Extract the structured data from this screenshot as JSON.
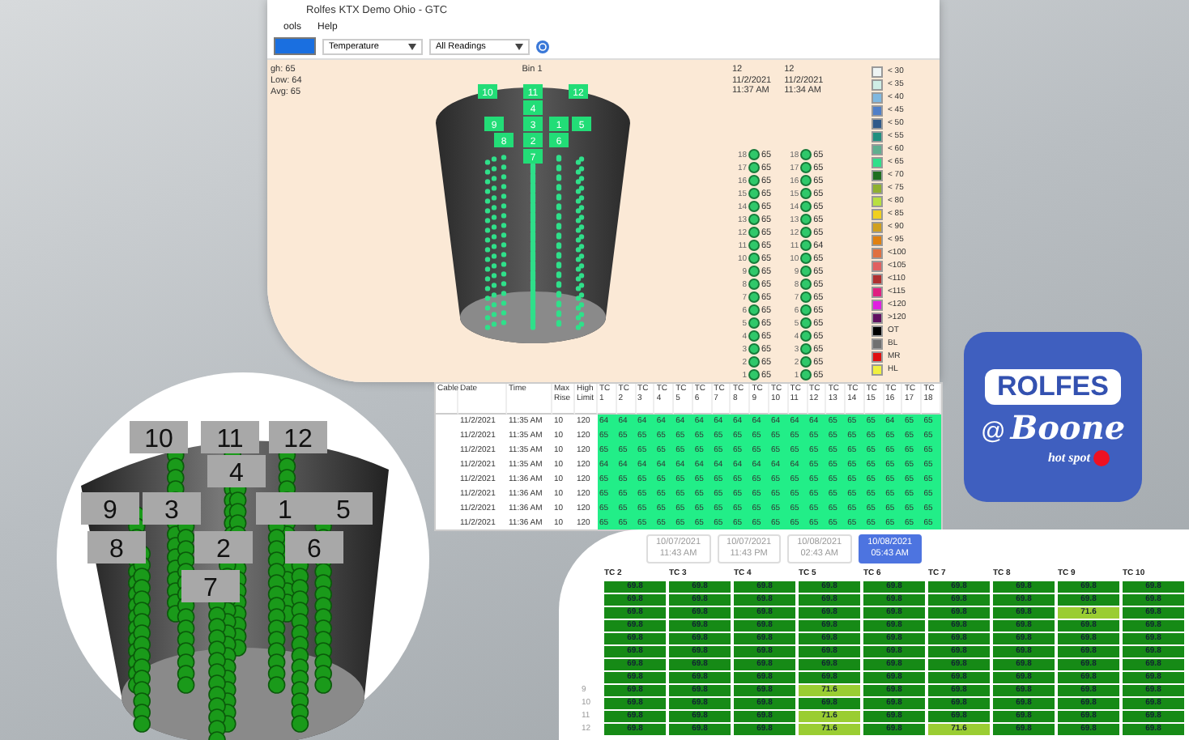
{
  "window": {
    "title": "Rolfes KTX Demo Ohio - GTC",
    "menu": [
      "ools",
      "Help"
    ],
    "toolbar": {
      "dropdowns": [
        "Temperature",
        "All Readings"
      ]
    }
  },
  "stats": [
    "gh: 65",
    "Low: 64",
    "Avg: 65"
  ],
  "bin": {
    "title": "Bin 1",
    "cable_labels": [
      "10",
      "11",
      "12",
      "4",
      "9",
      "3",
      "1",
      "5",
      "8",
      "2",
      "6",
      "7"
    ]
  },
  "cable_readings": [
    {
      "cable": "12",
      "date": "11/2/2021",
      "time": "11:37 AM",
      "sensors": [
        {
          "number": "18",
          "value": "65"
        },
        {
          "number": "17",
          "value": "65"
        },
        {
          "number": "16",
          "value": "65"
        },
        {
          "number": "15",
          "value": "65"
        },
        {
          "number": "14",
          "value": "65"
        },
        {
          "number": "13",
          "value": "65"
        },
        {
          "number": "12",
          "value": "65"
        },
        {
          "number": "11",
          "value": "65"
        },
        {
          "number": "10",
          "value": "65"
        },
        {
          "number": "9",
          "value": "65"
        },
        {
          "number": "8",
          "value": "65"
        },
        {
          "number": "7",
          "value": "65"
        },
        {
          "number": "6",
          "value": "65"
        },
        {
          "number": "5",
          "value": "65"
        },
        {
          "number": "4",
          "value": "65"
        },
        {
          "number": "3",
          "value": "65"
        },
        {
          "number": "2",
          "value": "65"
        },
        {
          "number": "1",
          "value": "65"
        }
      ]
    },
    {
      "cable": "12",
      "date": "11/2/2021",
      "time": "11:34 AM",
      "sensors": [
        {
          "number": "18",
          "value": "65"
        },
        {
          "number": "17",
          "value": "65"
        },
        {
          "number": "16",
          "value": "65"
        },
        {
          "number": "15",
          "value": "65"
        },
        {
          "number": "14",
          "value": "65"
        },
        {
          "number": "13",
          "value": "65"
        },
        {
          "number": "12",
          "value": "65"
        },
        {
          "number": "11",
          "value": "64"
        },
        {
          "number": "10",
          "value": "65"
        },
        {
          "number": "9",
          "value": "65"
        },
        {
          "number": "8",
          "value": "65"
        },
        {
          "number": "7",
          "value": "65"
        },
        {
          "number": "6",
          "value": "65"
        },
        {
          "number": "5",
          "value": "65"
        },
        {
          "number": "4",
          "value": "65"
        },
        {
          "number": "3",
          "value": "65"
        },
        {
          "number": "2",
          "value": "65"
        },
        {
          "number": "1",
          "value": "65"
        }
      ]
    }
  ],
  "legend": [
    {
      "label": "< 30",
      "color": "#eef4f4"
    },
    {
      "label": "< 35",
      "color": "#cfeee6"
    },
    {
      "label": "< 40",
      "color": "#7fb8e0"
    },
    {
      "label": "< 45",
      "color": "#4f7fc8"
    },
    {
      "label": "< 50",
      "color": "#2f5a8a"
    },
    {
      "label": "< 55",
      "color": "#1f8f7f"
    },
    {
      "label": "< 60",
      "color": "#5faf8f"
    },
    {
      "label": "< 65",
      "color": "#2fe08a"
    },
    {
      "label": "< 70",
      "color": "#1f6f1f"
    },
    {
      "label": "< 75",
      "color": "#8fb030"
    },
    {
      "label": "< 80",
      "color": "#b8e040"
    },
    {
      "label": "< 85",
      "color": "#f0d020"
    },
    {
      "label": "< 90",
      "color": "#d0a020"
    },
    {
      "label": "< 95",
      "color": "#e08010"
    },
    {
      "label": "<100",
      "color": "#e07040"
    },
    {
      "label": "<105",
      "color": "#e06060"
    },
    {
      "label": "<110",
      "color": "#b03030"
    },
    {
      "label": "<115",
      "color": "#e02080"
    },
    {
      "label": "<120",
      "color": "#e020e0"
    },
    {
      "label": ">120",
      "color": "#601060"
    },
    {
      "label": "OT",
      "color": "#000000"
    },
    {
      "label": "BL",
      "color": "#707070"
    },
    {
      "label": "MR",
      "color": "#e01010"
    },
    {
      "label": "HL",
      "color": "#f0f040"
    }
  ],
  "table": {
    "columns": [
      "Cable",
      "Date",
      "Time",
      "Max Rise",
      "High Limit",
      "TC 1",
      "TC 2",
      "TC 3",
      "TC 4",
      "TC 5",
      "TC 6",
      "TC 7",
      "TC 8",
      "TC 9",
      "TC 10",
      "TC 11",
      "TC 12",
      "TC 13",
      "TC 14",
      "TC 15",
      "TC 16",
      "TC 17",
      "TC 18"
    ],
    "rows": [
      {
        "date": "11/2/2021",
        "time": "11:35 AM",
        "max_rise": "10",
        "high_limit": "120",
        "values": [
          "64",
          "64",
          "64",
          "64",
          "64",
          "64",
          "64",
          "64",
          "64",
          "64",
          "64",
          "64",
          "65",
          "65",
          "65",
          "64",
          "65",
          "65"
        ]
      },
      {
        "date": "11/2/2021",
        "time": "11:35 AM",
        "max_rise": "10",
        "high_limit": "120",
        "values": [
          "65",
          "65",
          "65",
          "65",
          "65",
          "65",
          "65",
          "65",
          "65",
          "65",
          "65",
          "65",
          "65",
          "65",
          "65",
          "65",
          "65",
          "65"
        ]
      },
      {
        "date": "11/2/2021",
        "time": "11:35 AM",
        "max_rise": "10",
        "high_limit": "120",
        "values": [
          "65",
          "65",
          "65",
          "65",
          "65",
          "65",
          "65",
          "65",
          "65",
          "65",
          "65",
          "65",
          "65",
          "65",
          "65",
          "65",
          "65",
          "65"
        ]
      },
      {
        "date": "11/2/2021",
        "time": "11:35 AM",
        "max_rise": "10",
        "high_limit": "120",
        "values": [
          "64",
          "64",
          "64",
          "64",
          "64",
          "64",
          "64",
          "64",
          "64",
          "64",
          "64",
          "65",
          "65",
          "65",
          "65",
          "65",
          "65",
          "65"
        ]
      },
      {
        "date": "11/2/2021",
        "time": "11:36 AM",
        "max_rise": "10",
        "high_limit": "120",
        "values": [
          "65",
          "65",
          "65",
          "65",
          "65",
          "65",
          "65",
          "65",
          "65",
          "65",
          "65",
          "65",
          "65",
          "65",
          "65",
          "65",
          "65",
          "65"
        ]
      },
      {
        "date": "11/2/2021",
        "time": "11:36 AM",
        "max_rise": "10",
        "high_limit": "120",
        "values": [
          "65",
          "65",
          "65",
          "65",
          "65",
          "65",
          "65",
          "65",
          "65",
          "65",
          "65",
          "65",
          "65",
          "65",
          "65",
          "65",
          "65",
          "65"
        ]
      },
      {
        "date": "11/2/2021",
        "time": "11:36 AM",
        "max_rise": "10",
        "high_limit": "120",
        "values": [
          "65",
          "65",
          "65",
          "65",
          "65",
          "65",
          "65",
          "65",
          "65",
          "65",
          "65",
          "65",
          "65",
          "65",
          "65",
          "65",
          "65",
          "65"
        ]
      },
      {
        "date": "11/2/2021",
        "time": "11:36 AM",
        "max_rise": "10",
        "high_limit": "120",
        "values": [
          "65",
          "65",
          "65",
          "65",
          "65",
          "65",
          "65",
          "65",
          "65",
          "65",
          "65",
          "65",
          "65",
          "65",
          "65",
          "65",
          "65",
          "65"
        ]
      }
    ]
  },
  "bin_3d": {
    "cable_labels": [
      "10",
      "11",
      "12",
      "4",
      "9",
      "3",
      "1",
      "5",
      "8",
      "2",
      "6",
      "7"
    ]
  },
  "logo": {
    "name": "ROLFES",
    "at": "@",
    "place": "Boone",
    "tagline": "hot spot"
  },
  "web": {
    "readings": [
      {
        "date": "10/07/2021",
        "time": "11:43 AM",
        "selected": false
      },
      {
        "date": "10/07/2021",
        "time": "11:43 PM",
        "selected": false
      },
      {
        "date": "10/08/2021",
        "time": "02:43 AM",
        "selected": false
      },
      {
        "date": "10/08/2021",
        "time": "05:43 AM",
        "selected": true
      }
    ],
    "columns": [
      "TC 2",
      "TC 3",
      "TC 4",
      "TC 5",
      "TC 6",
      "TC 7",
      "TC 8",
      "TC 9",
      "TC 10"
    ],
    "rows": [
      {
        "cells": [
          {
            "value": "69.8",
            "hot": false
          },
          {
            "value": "69.8",
            "hot": false
          },
          {
            "value": "69.8",
            "hot": false
          },
          {
            "value": "69.8",
            "hot": false
          },
          {
            "value": "69.8",
            "hot": false
          },
          {
            "value": "69.8",
            "hot": false
          },
          {
            "value": "69.8",
            "hot": false
          },
          {
            "value": "69.8",
            "hot": false
          },
          {
            "value": "69.8",
            "hot": false
          }
        ]
      },
      {
        "cells": [
          {
            "value": "69.8",
            "hot": false
          },
          {
            "value": "69.8",
            "hot": false
          },
          {
            "value": "69.8",
            "hot": false
          },
          {
            "value": "69.8",
            "hot": false
          },
          {
            "value": "69.8",
            "hot": false
          },
          {
            "value": "69.8",
            "hot": false
          },
          {
            "value": "69.8",
            "hot": false
          },
          {
            "value": "69.8",
            "hot": false
          },
          {
            "value": "69.8",
            "hot": false
          }
        ]
      },
      {
        "cells": [
          {
            "value": "69.8",
            "hot": false
          },
          {
            "value": "69.8",
            "hot": false
          },
          {
            "value": "69.8",
            "hot": false
          },
          {
            "value": "69.8",
            "hot": false
          },
          {
            "value": "69.8",
            "hot": false
          },
          {
            "value": "69.8",
            "hot": false
          },
          {
            "value": "69.8",
            "hot": false
          },
          {
            "value": "71.6",
            "hot": true
          },
          {
            "value": "69.8",
            "hot": false
          }
        ]
      },
      {
        "cells": [
          {
            "value": "69.8",
            "hot": false
          },
          {
            "value": "69.8",
            "hot": false
          },
          {
            "value": "69.8",
            "hot": false
          },
          {
            "value": "69.8",
            "hot": false
          },
          {
            "value": "69.8",
            "hot": false
          },
          {
            "value": "69.8",
            "hot": false
          },
          {
            "value": "69.8",
            "hot": false
          },
          {
            "value": "69.8",
            "hot": false
          },
          {
            "value": "69.8",
            "hot": false
          }
        ]
      },
      {
        "cells": [
          {
            "value": "69.8",
            "hot": false
          },
          {
            "value": "69.8",
            "hot": false
          },
          {
            "value": "69.8",
            "hot": false
          },
          {
            "value": "69.8",
            "hot": false
          },
          {
            "value": "69.8",
            "hot": false
          },
          {
            "value": "69.8",
            "hot": false
          },
          {
            "value": "69.8",
            "hot": false
          },
          {
            "value": "69.8",
            "hot": false
          },
          {
            "value": "69.8",
            "hot": false
          }
        ]
      },
      {
        "cells": [
          {
            "value": "69.8",
            "hot": false
          },
          {
            "value": "69.8",
            "hot": false
          },
          {
            "value": "69.8",
            "hot": false
          },
          {
            "value": "69.8",
            "hot": false
          },
          {
            "value": "69.8",
            "hot": false
          },
          {
            "value": "69.8",
            "hot": false
          },
          {
            "value": "69.8",
            "hot": false
          },
          {
            "value": "69.8",
            "hot": false
          },
          {
            "value": "69.8",
            "hot": false
          }
        ]
      },
      {
        "cells": [
          {
            "value": "69.8",
            "hot": false
          },
          {
            "value": "69.8",
            "hot": false
          },
          {
            "value": "69.8",
            "hot": false
          },
          {
            "value": "69.8",
            "hot": false
          },
          {
            "value": "69.8",
            "hot": false
          },
          {
            "value": "69.8",
            "hot": false
          },
          {
            "value": "69.8",
            "hot": false
          },
          {
            "value": "69.8",
            "hot": false
          },
          {
            "value": "69.8",
            "hot": false
          }
        ]
      },
      {
        "cells": [
          {
            "value": "69.8",
            "hot": false
          },
          {
            "value": "69.8",
            "hot": false
          },
          {
            "value": "69.8",
            "hot": false
          },
          {
            "value": "69.8",
            "hot": false
          },
          {
            "value": "69.8",
            "hot": false
          },
          {
            "value": "69.8",
            "hot": false
          },
          {
            "value": "69.8",
            "hot": false
          },
          {
            "value": "69.8",
            "hot": false
          },
          {
            "value": "69.8",
            "hot": false
          }
        ]
      },
      {
        "label": "9",
        "cells": [
          {
            "value": "69.8",
            "hot": false
          },
          {
            "value": "69.8",
            "hot": false
          },
          {
            "value": "69.8",
            "hot": false
          },
          {
            "value": "71.6",
            "hot": true
          },
          {
            "value": "69.8",
            "hot": false
          },
          {
            "value": "69.8",
            "hot": false
          },
          {
            "value": "69.8",
            "hot": false
          },
          {
            "value": "69.8",
            "hot": false
          },
          {
            "value": "69.8",
            "hot": false
          }
        ]
      },
      {
        "label": "10",
        "cells": [
          {
            "value": "69.8",
            "hot": false
          },
          {
            "value": "69.8",
            "hot": false
          },
          {
            "value": "69.8",
            "hot": false
          },
          {
            "value": "69.8",
            "hot": false
          },
          {
            "value": "69.8",
            "hot": false
          },
          {
            "value": "69.8",
            "hot": false
          },
          {
            "value": "69.8",
            "hot": false
          },
          {
            "value": "69.8",
            "hot": false
          },
          {
            "value": "69.8",
            "hot": false
          }
        ]
      },
      {
        "label": "11",
        "cells": [
          {
            "value": "69.8",
            "hot": false
          },
          {
            "value": "69.8",
            "hot": false
          },
          {
            "value": "69.8",
            "hot": false
          },
          {
            "value": "71.6",
            "hot": true
          },
          {
            "value": "69.8",
            "hot": false
          },
          {
            "value": "69.8",
            "hot": false
          },
          {
            "value": "69.8",
            "hot": false
          },
          {
            "value": "69.8",
            "hot": false
          },
          {
            "value": "69.8",
            "hot": false
          }
        ]
      },
      {
        "label": "12",
        "cells": [
          {
            "value": "69.8",
            "hot": false
          },
          {
            "value": "69.8",
            "hot": false
          },
          {
            "value": "69.8",
            "hot": false
          },
          {
            "value": "71.6",
            "hot": true
          },
          {
            "value": "69.8",
            "hot": false
          },
          {
            "value": "71.6",
            "hot": true
          },
          {
            "value": "69.8",
            "hot": false
          },
          {
            "value": "69.8",
            "hot": false
          },
          {
            "value": "69.8",
            "hot": false
          }
        ]
      }
    ]
  }
}
